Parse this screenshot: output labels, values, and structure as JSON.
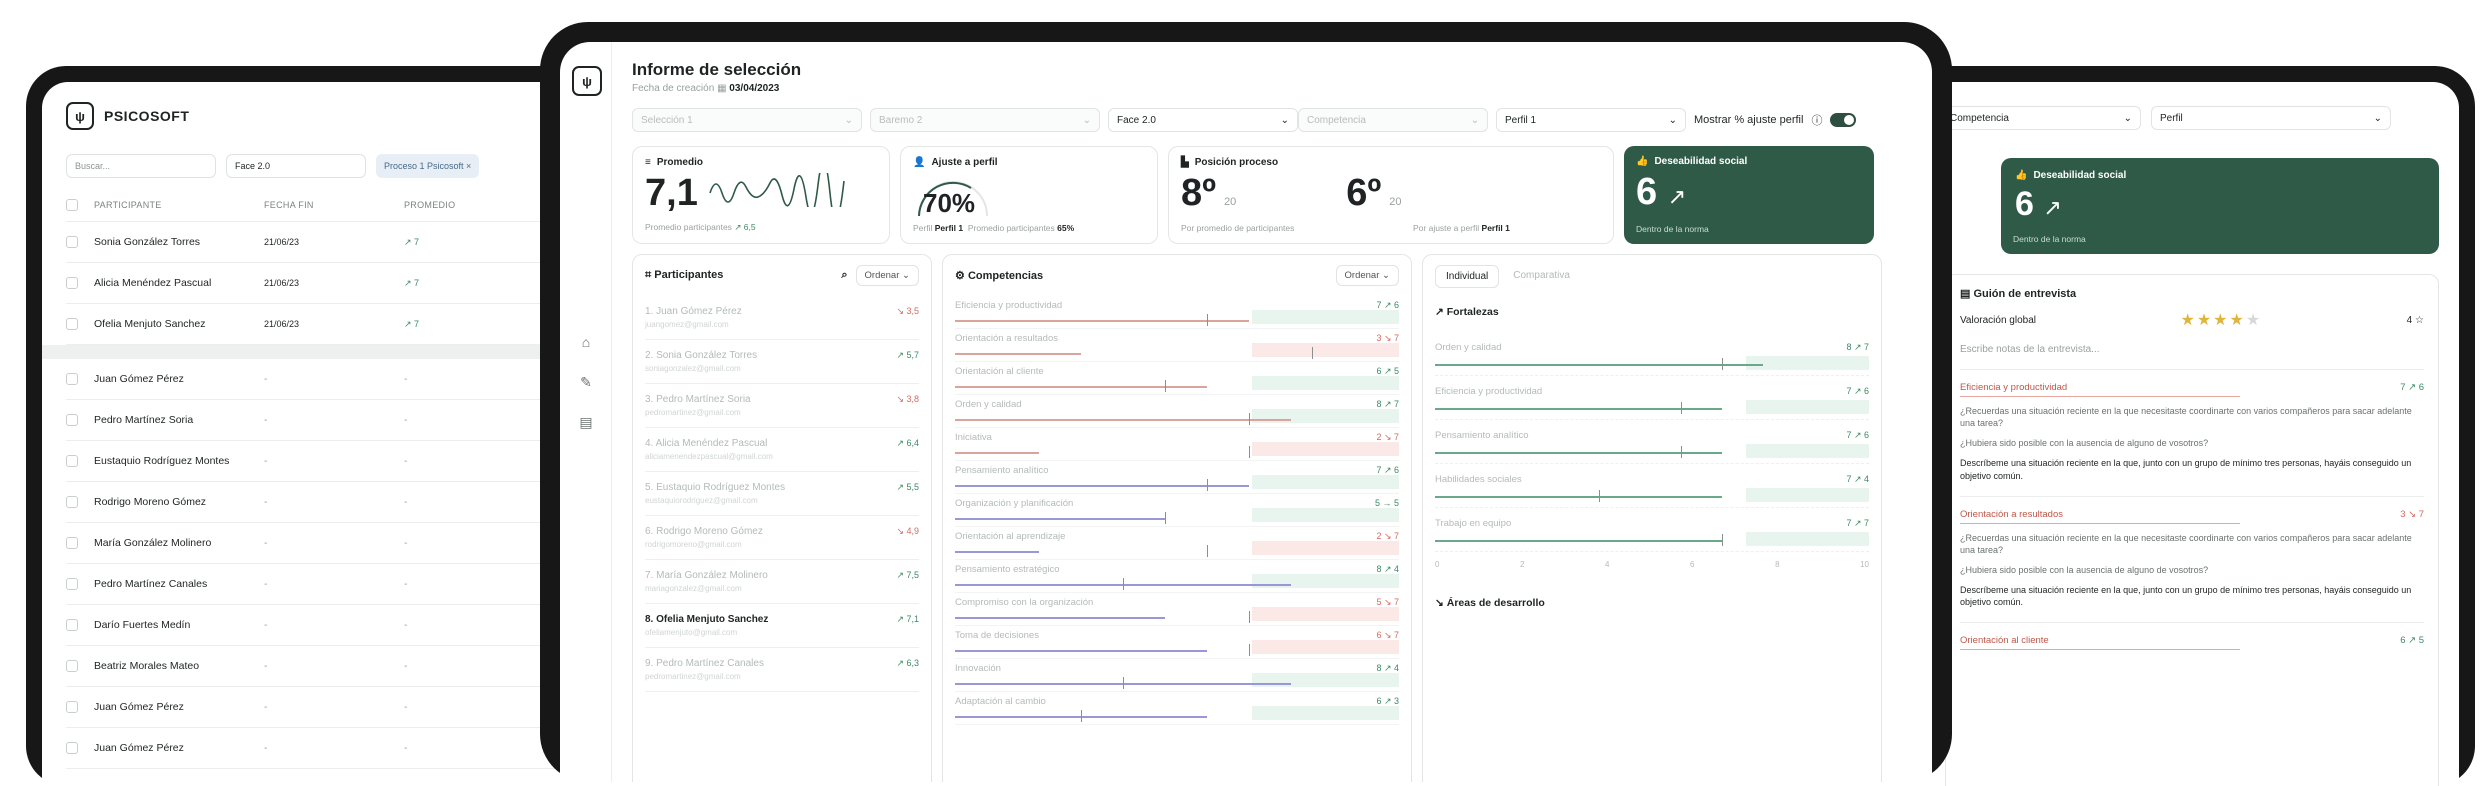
{
  "left_app": {
    "brand": "PSICOSOFT",
    "search_placeholder": "Buscar...",
    "phase_filter": "Face 2.0",
    "chip": "Proceso 1 Psicosoft ×",
    "columns": [
      "PARTICIPANTE",
      "FECHA FIN",
      "PROMEDIO"
    ],
    "rows_top": [
      {
        "name": "Sonia González Torres",
        "date": "21/06/23",
        "avg": "↗ 7"
      },
      {
        "name": "Alicia Menéndez Pascual",
        "date": "21/06/23",
        "avg": "↗ 7"
      },
      {
        "name": "Ofelia Menjuto Sanchez",
        "date": "21/06/23",
        "avg": "↗ 7"
      }
    ],
    "rows_bottom": [
      "Juan Gómez Pérez",
      "Pedro Martínez Soria",
      "Eustaquio Rodríguez Montes",
      "Rodrigo Moreno Gómez",
      "María González Molinero",
      "Pedro Martínez Canales",
      "Darío Fuertes Medín",
      "Beatriz Morales Mateo",
      "Juan Gómez Pérez",
      "Juan Gómez Pérez"
    ],
    "dash": "-"
  },
  "report": {
    "title": "Informe de selección",
    "date_label": "Fecha de creación",
    "date_value": "03/04/2023",
    "filters": [
      "Selección 1",
      "Baremo 2",
      "Face 2.0",
      "Competencia",
      "Perfil 1"
    ],
    "toggle_label": "Mostrar % ajuste perfil",
    "cards": {
      "promedio": {
        "title": "Promedio",
        "value": "7,1",
        "foot": "Promedio participantes",
        "foot_val": "↗ 6,5"
      },
      "ajuste": {
        "title": "Ajuste a perfil",
        "value": "70%",
        "foot1": "Perfil",
        "foot1_val": "Perfil 1",
        "foot2": "Promedio participantes",
        "foot2_val": "65%"
      },
      "posicion": {
        "title": "Posición proceso",
        "value1": "8º",
        "of1": "20",
        "foot1": "Por promedio de participantes",
        "value2": "6º",
        "of2": "20",
        "foot2": "Por ajuste a perfil",
        "foot2_val": "Perfil 1"
      },
      "deseabilidad": {
        "title": "Deseabilidad social",
        "value": "6",
        "foot": "Dentro de la norma"
      }
    },
    "participants_title": "Participantes",
    "order_label": "Ordenar",
    "participants": [
      {
        "name": "1. Juan Gómez Pérez",
        "email": "juangomez@gmail.com",
        "score": "↘ 3,5",
        "neg": true
      },
      {
        "name": "2. Sonia González Torres",
        "email": "soniagonzalez@gmail.com",
        "score": "↗ 5,7",
        "neg": false
      },
      {
        "name": "3. Pedro Martínez Soria",
        "email": "pedromartinez@gmail.com",
        "score": "↘ 3,8",
        "neg": true
      },
      {
        "name": "4. Alicia Menéndez Pascual",
        "email": "aliciamenendezpascual@gmail.com",
        "score": "↗ 6,4",
        "neg": false
      },
      {
        "name": "5. Eustaquio Rodríguez Montes",
        "email": "eustaquiorodriguez@gmail.com",
        "score": "↗ 5,5",
        "neg": false
      },
      {
        "name": "6. Rodrigo Moreno Gómez",
        "email": "rodrigomoreno@gmail.com",
        "score": "↘ 4,9",
        "neg": true
      },
      {
        "name": "7. María González Molinero",
        "email": "mariagonzalez@gmail.com",
        "score": "↗ 7,5",
        "neg": false
      },
      {
        "name": "8. Ofelia Menjuto Sanchez",
        "email": "ofeliamenjuto@gmail.com",
        "score": "↗ 7,1",
        "neg": false
      },
      {
        "name": "9. Pedro Martínez Canales",
        "email": "pedromartinez@gmail.com",
        "score": "↗ 6,3",
        "neg": false
      }
    ],
    "competencias_title": "Competencias",
    "competencias": [
      {
        "name": "Eficiencia y productividad",
        "val": "7 ↗ 6",
        "level": 0.7,
        "mark": 0.6,
        "color": "#d9a49a",
        "neg": false
      },
      {
        "name": "Orientación a resultados",
        "val": "3 ↘ 7",
        "level": 0.3,
        "mark": 0.85,
        "color": "#d9a49a",
        "neg": true
      },
      {
        "name": "Orientación al cliente",
        "val": "6 ↗ 5",
        "level": 0.6,
        "mark": 0.5,
        "color": "#d9a49a",
        "neg": false
      },
      {
        "name": "Orden y calidad",
        "val": "8 ↗ 7",
        "level": 0.8,
        "mark": 0.7,
        "color": "#d9a49a",
        "neg": false
      },
      {
        "name": "Iniciativa",
        "val": "2 ↘ 7",
        "level": 0.2,
        "mark": 0.7,
        "color": "#d9a49a",
        "neg": true
      },
      {
        "name": "Pensamiento analítico",
        "val": "7 ↗ 6",
        "level": 0.7,
        "mark": 0.6,
        "color": "#9a97d9",
        "neg": false
      },
      {
        "name": "Organización y planificación",
        "val": "5 → 5",
        "level": 0.5,
        "mark": 0.5,
        "color": "#9a97d9",
        "neg": false
      },
      {
        "name": "Orientación al aprendizaje",
        "val": "2 ↘ 7",
        "level": 0.2,
        "mark": 0.6,
        "color": "#9a97d9",
        "neg": true
      },
      {
        "name": "Pensamiento estratégico",
        "val": "8 ↗ 4",
        "level": 0.8,
        "mark": 0.4,
        "color": "#9a97d9",
        "neg": false
      },
      {
        "name": "Compromiso con la organización",
        "val": "5 ↘ 7",
        "level": 0.5,
        "mark": 0.7,
        "color": "#9a97d9",
        "neg": true
      },
      {
        "name": "Toma de decisiones",
        "val": "6 ↘ 7",
        "level": 0.6,
        "mark": 0.7,
        "color": "#9a97d9",
        "neg": true
      },
      {
        "name": "Innovación",
        "val": "8 ↗ 4",
        "level": 0.8,
        "mark": 0.4,
        "color": "#9a97d9",
        "neg": false
      },
      {
        "name": "Adaptación al cambio",
        "val": "6 ↗ 3",
        "level": 0.6,
        "mark": 0.3,
        "color": "#9a97d9",
        "neg": false
      }
    ],
    "tab_individual": "Individual",
    "tab_comparativa": "Comparativa",
    "fortalezas_title": "Fortalezas",
    "fortalezas": [
      {
        "name": "Orden y calidad",
        "val": "8 ↗ 7",
        "level": 0.8,
        "mark": 0.7
      },
      {
        "name": "Eficiencia y productividad",
        "val": "7 ↗ 6",
        "level": 0.7,
        "mark": 0.6
      },
      {
        "name": "Pensamiento analítico",
        "val": "7 ↗ 6",
        "level": 0.7,
        "mark": 0.6
      },
      {
        "name": "Habilidades sociales",
        "val": "7 ↗ 4",
        "level": 0.7,
        "mark": 0.4
      },
      {
        "name": "Trabajo en equipo",
        "val": "7 ↗ 7",
        "level": 0.7,
        "mark": 0.7
      }
    ],
    "axis": [
      "0",
      "2",
      "4",
      "6",
      "8",
      "10"
    ],
    "desarrollo_title": "Áreas de desarrollo"
  },
  "right_app": {
    "filter1": "Competencia",
    "filter2": "Perfil",
    "card_title": "Deseabilidad social",
    "card_value": "6",
    "card_foot": "Dentro de la norma",
    "guion_title": "Guión de entrevista",
    "valoracion": "Valoración global",
    "rating": 4,
    "rating_text": "4 ☆",
    "notes_placeholder": "Escribe notas de la entrevista...",
    "sections": [
      {
        "title": "Eficiencia y productividad",
        "val": "7 ↗ 6",
        "q1": "¿Recuerdas una situación reciente en la que necesitaste coordinarte con varios compañeros para sacar adelante una tarea?",
        "q2": "¿Hubiera sido posible con la ausencia de alguno de vosotros?",
        "q3": "Descríbeme una situación reciente en la que, junto con un grupo de mínimo tres personas, hayáis conseguido un objetivo común."
      },
      {
        "title": "Orientación a resultados",
        "val": "3 ↘ 7",
        "q1": "¿Recuerdas una situación reciente en la que necesitaste coordinarte con varios compañeros para sacar adelante una tarea?",
        "q2": "¿Hubiera sido posible con la ausencia de alguno de vosotros?",
        "q3": "Descríbeme una situación reciente en la que, junto con un grupo de mínimo tres personas, hayáis conseguido un objetivo común."
      },
      {
        "title": "Orientación al cliente",
        "val": "6 ↗ 5",
        "q1": "",
        "q2": "",
        "q3": ""
      }
    ]
  },
  "colors": {
    "accent": "#2f5a48",
    "positive": "#3c8a64",
    "negative": "#d46a5e",
    "red_band": "#fbe9e7",
    "green_band": "#e8f4ee"
  }
}
